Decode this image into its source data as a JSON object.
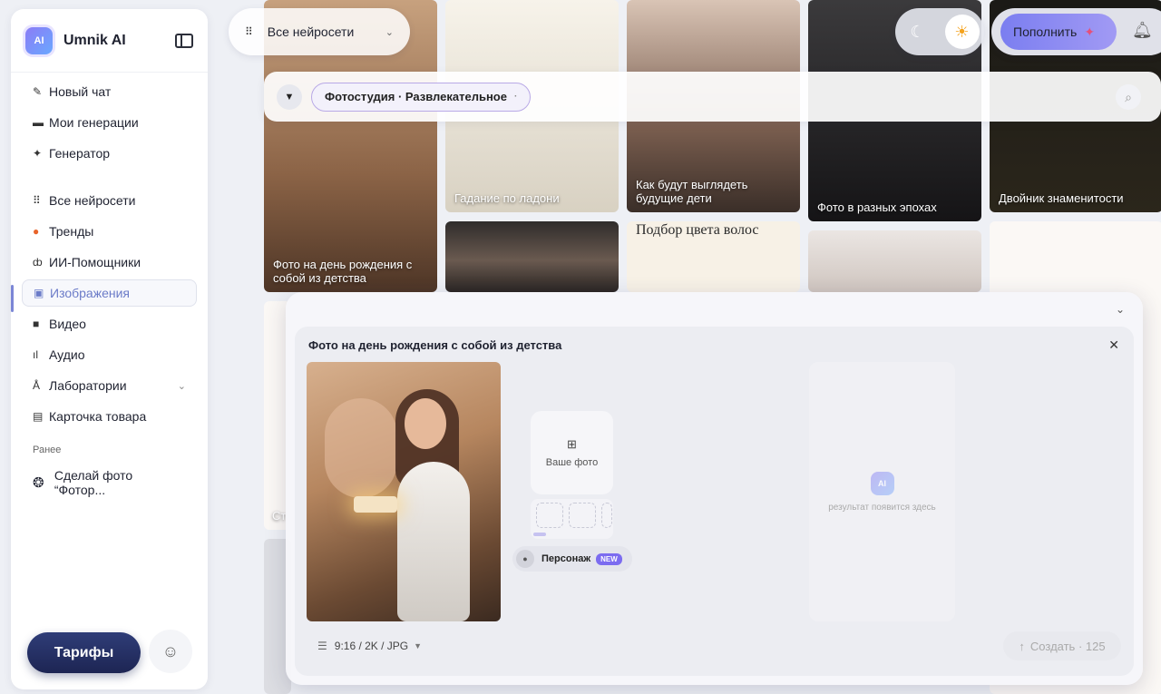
{
  "sidebar": {
    "brand": "Umnik AI",
    "logo_text": "AI",
    "nav_primary": [
      {
        "label": "Новый чат",
        "icon": "pencil-icon"
      },
      {
        "label": "Мои генерации",
        "icon": "folder-icon"
      },
      {
        "label": "Генератор",
        "icon": "sparkle-icon"
      }
    ],
    "nav_secondary": [
      {
        "label": "Все нейросети",
        "icon": "grid-icon"
      },
      {
        "label": "Тренды",
        "icon": "fire-icon"
      },
      {
        "label": "ИИ-Помощники",
        "icon": "robot-icon"
      },
      {
        "label": "Изображения",
        "icon": "image-icon",
        "active": true
      },
      {
        "label": "Видео",
        "icon": "video-icon"
      },
      {
        "label": "Аудио",
        "icon": "audio-wave-icon"
      },
      {
        "label": "Лаборатории",
        "icon": "flask-icon"
      },
      {
        "label": "Карточка товара",
        "icon": "card-icon"
      }
    ],
    "recent_title": "Ранее",
    "recent_item": "Сделай фото “Фотор...",
    "tariffs_label": "Тарифы"
  },
  "topbar": {
    "models_label": "Все нейросети",
    "topup_label": "Пополнить"
  },
  "filter": {
    "chip_label": "Фотостудия · Развлекательное",
    "chip_suffix": "·"
  },
  "gallery": {
    "captions": [
      "Фото на день рождения с собой из детства",
      "Гадание по ладони",
      "Как будут выглядеть будущие дети",
      "Фото в разных эпохах",
      "Двойник знаменитости",
      "Подбор цвета волос",
      "Ст"
    ]
  },
  "modal": {
    "title": "Фото на день рождения с собой из детства",
    "upload_label": "Ваше фото",
    "persona_label": "Персонаж",
    "persona_badge": "NEW",
    "result_placeholder": "результат появится здесь",
    "result_badge": "AI",
    "settings_value": "9:16 / 2K / JPG",
    "create_label": "Создать · 125"
  },
  "colors": {
    "accent": "#7b7ef0",
    "tariffs_bg": "#1d2553",
    "active_nav": "#6b7bc8",
    "new_badge": "#7c6cf0"
  }
}
